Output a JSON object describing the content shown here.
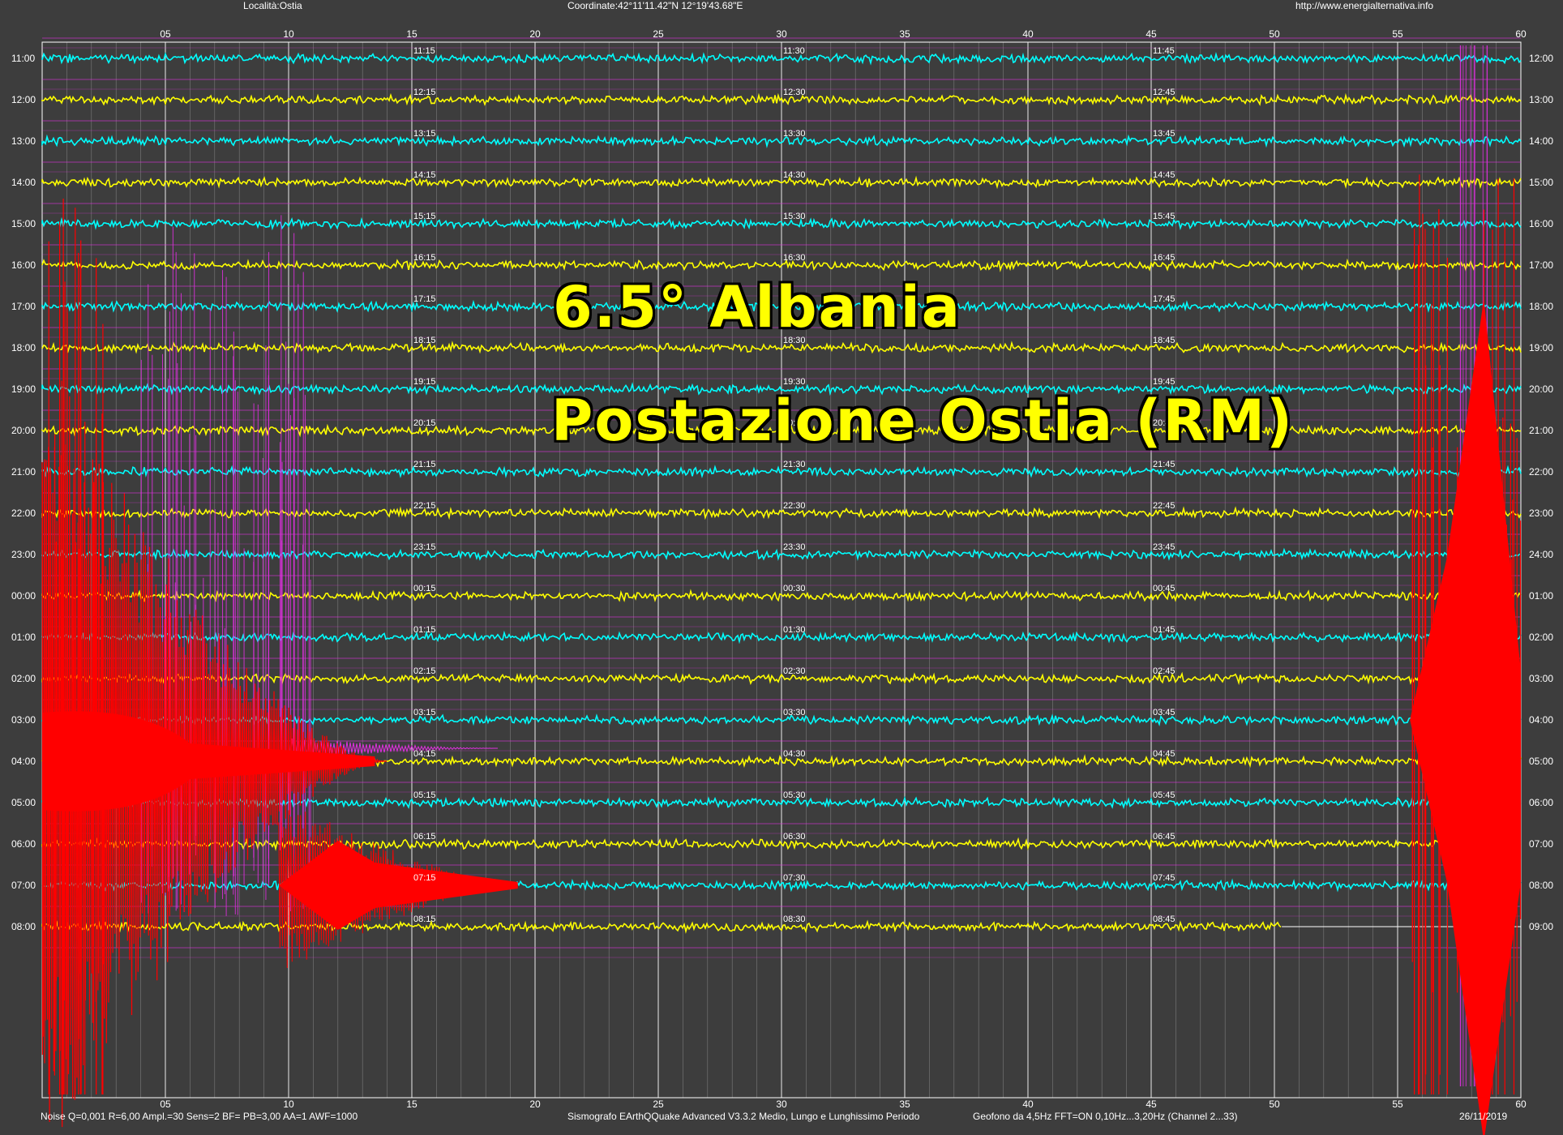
{
  "header": {
    "location": "Località:Ostia",
    "coordinates": "Coordinate:42°11'11.42\"N  12°19'43.68\"E",
    "url": "http://www.energialternativa.info"
  },
  "overlay": {
    "line1": "6.5° Albania",
    "line2": "Postazione Ostia (RM)"
  },
  "footer": {
    "settings": "Noise Q=0,001 R=6,00 Ampl.=30 Sens=2 BF= PB=3,00 AA=1 AWF=1000",
    "software": "Sismografo  EArthQQuake Advanced V3.3.2  Medio, Lungo e Lunghissimo Periodo",
    "geophone": "Geofono da 4,5Hz FFT=ON 0,10Hz...3,20Hz      (Channel 2...33)",
    "date": "26/11/2019"
  },
  "colors": {
    "background": "#3d3d3d",
    "grid_minor": "#b0b0b0",
    "grid_major": "#ffffff",
    "trace_cyan": "#00ffff",
    "trace_yellow": "#ffff00",
    "quake": "#ff0000",
    "long_period": "#e030e0"
  },
  "chart_data": {
    "type": "seismogram",
    "x_ticks": [
      "05",
      "10",
      "15",
      "20",
      "25",
      "30",
      "35",
      "40",
      "45",
      "50",
      "55",
      "60"
    ],
    "x_range_minutes": [
      0,
      60
    ],
    "rows_left": [
      "11:00",
      "12:00",
      "13:00",
      "14:00",
      "15:00",
      "16:00",
      "17:00",
      "18:00",
      "19:00",
      "20:00",
      "21:00",
      "22:00",
      "23:00",
      "00:00",
      "01:00",
      "02:00",
      "03:00",
      "04:00",
      "05:00",
      "06:00",
      "07:00",
      "08:00"
    ],
    "rows_right": [
      "12:00",
      "13:00",
      "14:00",
      "15:00",
      "16:00",
      "17:00",
      "18:00",
      "19:00",
      "20:00",
      "21:00",
      "22:00",
      "23:00",
      "24:00",
      "01:00",
      "02:00",
      "03:00",
      "04:00",
      "05:00",
      "06:00",
      "07:00",
      "08:00",
      "09:00"
    ],
    "labels_15": [
      "11:15",
      "12:15",
      "13:15",
      "14:15",
      "15:15",
      "16:15",
      "17:15",
      "18:15",
      "19:15",
      "20:15",
      "21:15",
      "22:15",
      "23:15",
      "00:15",
      "01:15",
      "02:15",
      "03:15",
      "04:15",
      "05:15",
      "06:15",
      "07:15",
      "08:15"
    ],
    "labels_30": [
      "11:30",
      "12:30",
      "13:30",
      "14:30",
      "15:30",
      "16:30",
      "17:30",
      "18:30",
      "19:30",
      "20:30",
      "21:30",
      "22:30",
      "23:30",
      "00:30",
      "01:30",
      "02:30",
      "03:30",
      "04:30",
      "05:30",
      "06:30",
      "07:30",
      "08:30"
    ],
    "labels_45": [
      "11:45",
      "12:45",
      "13:45",
      "14:45",
      "15:45",
      "16:45",
      "17:45",
      "18:45",
      "19:45",
      "20:45",
      "21:45",
      "22:45",
      "23:45",
      "00:45",
      "01:45",
      "02:45",
      "03:45",
      "04:45",
      "05:45",
      "06:45",
      "07:45",
      "08:45"
    ],
    "row_colors": [
      "cyan",
      "yellow",
      "cyan",
      "yellow",
      "cyan",
      "yellow",
      "cyan",
      "yellow",
      "cyan",
      "yellow",
      "cyan",
      "yellow",
      "cyan",
      "yellow",
      "cyan",
      "yellow",
      "cyan",
      "yellow",
      "cyan",
      "yellow",
      "cyan",
      "yellow"
    ],
    "events": [
      {
        "name": "main-quake-end",
        "row": "03:00",
        "minute_start": 55.5,
        "minute_end": 60
      },
      {
        "name": "main-quake-start",
        "row": "04:00",
        "minute_start": 0,
        "minute_end": 14
      },
      {
        "name": "aftershock",
        "row": "07:00",
        "minute_start": 9.5,
        "minute_end": 19.5
      }
    ]
  }
}
